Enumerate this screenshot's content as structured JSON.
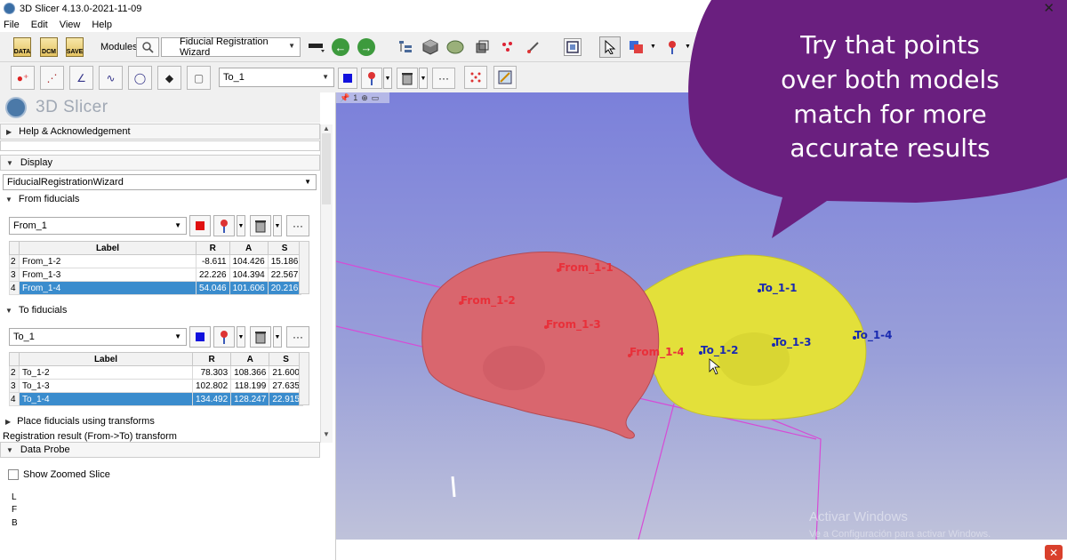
{
  "window": {
    "title": "3D Slicer 4.13.0-2021-11-09"
  },
  "menu": [
    "File",
    "Edit",
    "View",
    "Help"
  ],
  "toolbar": {
    "data_label": "DATA",
    "dcm_label": "DCM",
    "save_label": "SAVE",
    "modules_label": "Modules:",
    "module_selected": "Fiducial Registration Wizard"
  },
  "markups_toolbar": {
    "node_selected": "To_1"
  },
  "panel": {
    "logo_text": "3D Slicer",
    "help_section": "Help & Acknowledgement",
    "display_section": "Display",
    "wizard_node": "FiducialRegistrationWizard",
    "from_fiducials_label": "From fiducials",
    "to_fiducials_label": "To fiducials",
    "from_node": "From_1",
    "to_node": "To_1",
    "place_transforms_label": "Place fiducials using transforms",
    "registration_result_label": "Registration result (From->To) transform",
    "data_probe_label": "Data Probe",
    "show_zoomed_label": "Show Zoomed Slice",
    "coords": [
      "L",
      "F",
      "B"
    ]
  },
  "from_table": {
    "headers": [
      "",
      "Label",
      "R",
      "A",
      "S"
    ],
    "rows": [
      [
        "2",
        "From_1-2",
        "-8.611",
        "104.426",
        "15.186"
      ],
      [
        "3",
        "From_1-3",
        "22.226",
        "104.394",
        "22.567"
      ],
      [
        "4",
        "From_1-4",
        "54.046",
        "101.606",
        "20.216"
      ]
    ],
    "selected_index": 2
  },
  "to_table": {
    "headers": [
      "",
      "Label",
      "R",
      "A",
      "S"
    ],
    "rows": [
      [
        "2",
        "To_1-2",
        "78.303",
        "108.366",
        "21.600"
      ],
      [
        "3",
        "To_1-3",
        "102.802",
        "118.199",
        "27.635"
      ],
      [
        "4",
        "To_1-4",
        "134.492",
        "128.247",
        "22.915"
      ]
    ],
    "selected_index": 2
  },
  "view": {
    "view_number": "1",
    "from_labels": [
      "From_1-1",
      "From_1-2",
      "From_1-3",
      "From_1-4"
    ],
    "to_labels": [
      "To_1-1",
      "To_1-2",
      "To_1-3",
      "To_1-4"
    ],
    "from_color": "#e8303a",
    "to_color": "#1a2ab0",
    "red_model_color": "#d9666e",
    "yellow_model_color": "#e3e03a",
    "callout_lines": [
      "Try that points",
      "over both models",
      "match for more",
      "accurate results"
    ],
    "callout_color": "#6a1f7f",
    "watermark_line1": "Activar Windows",
    "watermark_line2": "Ve a Configuración para activar Windows."
  }
}
